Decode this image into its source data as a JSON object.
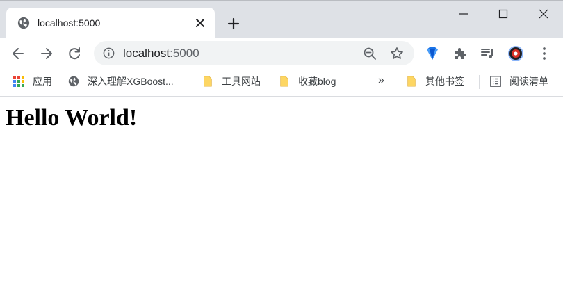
{
  "tab": {
    "title": "localhost:5000",
    "favicon_icon": "globe-icon",
    "close_icon": "close-icon"
  },
  "new_tab_icon": "plus-icon",
  "window_controls": [
    "minimize-icon",
    "maximize-icon",
    "close-icon"
  ],
  "toolbar": {
    "back_icon": "arrow-left-icon",
    "forward_icon": "arrow-right-icon",
    "reload_icon": "reload-icon",
    "omnibox": {
      "info_icon": "info-icon",
      "host": "localhost",
      "port": ":5000",
      "zoom_icon": "zoom-out-icon",
      "star_icon": "star-icon"
    },
    "extensions": [
      "gem-extension-icon",
      "puzzle-extensions-icon",
      "media-playlist-icon",
      "profile-avatar-icon",
      "more-vertical-icon"
    ]
  },
  "bookmarks": {
    "items": [
      {
        "label": "应用",
        "icon": "apps-grid-icon"
      },
      {
        "label": "深入理解XGBoost...",
        "icon": "globe-icon"
      },
      {
        "label": "工具网站",
        "icon": "folder-icon"
      },
      {
        "label": "收藏blog",
        "icon": "folder-icon"
      }
    ],
    "overflow": "»",
    "other": {
      "label": "其他书签",
      "icon": "folder-icon"
    },
    "reading_list": {
      "label": "阅读清单",
      "icon": "reading-list-icon"
    }
  },
  "page": {
    "heading": "Hello World!"
  },
  "colors": {
    "tabstrip": "#dee1e6",
    "omnibox": "#f1f3f4",
    "folder": "#fdd663",
    "icon": "#5f6368"
  }
}
